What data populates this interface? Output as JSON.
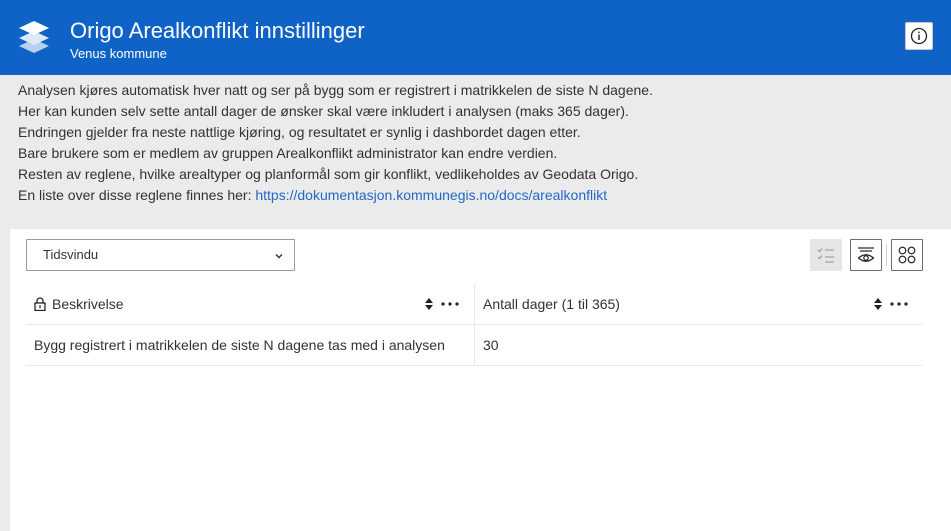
{
  "header": {
    "title": "Origo Arealkonflikt innstillinger",
    "subtitle": "Venus kommune",
    "logo_icon": "layers-icon",
    "info_icon": "info-icon",
    "background": "#0f63c6"
  },
  "description": {
    "lines": [
      "Analysen kjøres automatisk hver natt og ser på bygg som er registrert i matrikkelen de siste N dagene.",
      "Her kan kunden selv sette antall dager de ønsker skal være inkludert i analysen (maks 365 dager).",
      "Endringen gjelder fra neste nattlige kjøring, og resultatet er synlig i dashbordet dagen etter.",
      "Bare brukere som er medlem av gruppen Arealkonflikt administrator kan endre verdien.",
      "Resten av reglene, hvilke arealtyper og planformål som gir konflikt, vedlikeholdes av Geodata Origo."
    ],
    "link_prefix": "En liste over disse reglene finnes her: ",
    "link_text": "https://dokumentasjon.kommunegis.no/docs/arealkonflikt",
    "link_color": "#2169c4"
  },
  "toolbar": {
    "select_value": "Tidsvindu",
    "buttons": [
      "select-list-icon",
      "show-hide-icon",
      "grid-view-icon"
    ]
  },
  "table": {
    "columns": [
      "Beskrivelse",
      "Antall dager (1 til 365)"
    ],
    "rows": [
      [
        "Bygg registrert i matrikkelen de siste N dagene tas med i analysen",
        "30"
      ]
    ]
  }
}
